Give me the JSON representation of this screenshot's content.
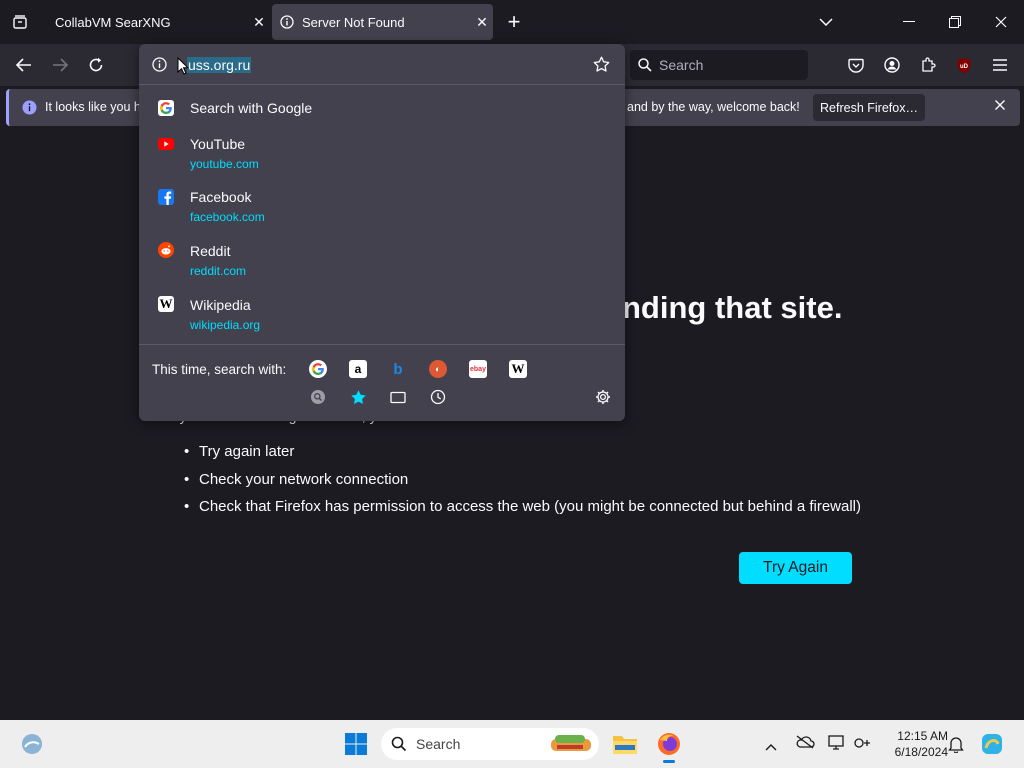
{
  "colors": {
    "accent": "#00ddff",
    "chrome_bg": "#2b2a33",
    "tab_bar_bg": "#1c1b22",
    "active_tab_bg": "#42414d",
    "dropdown_bg": "#42414d",
    "page_bg": "#1c1b22",
    "taskbar_bg": "#eeeeee"
  },
  "tabs": [
    {
      "title": "CollabVM SearXNG",
      "icon": "tab-list-icon"
    },
    {
      "title": "Server Not Found",
      "icon": "info-icon"
    }
  ],
  "toolbar": {
    "search_placeholder": "Search"
  },
  "urlbar": {
    "value": "uss.org.ru",
    "icon": "info-icon"
  },
  "notification": {
    "text_left": "It looks like you ha",
    "text_right": "and by the way, welcome back!",
    "button": "Refresh Firefox…"
  },
  "dropdown": {
    "search_with": "Search with Google",
    "results": [
      {
        "title": "YouTube",
        "url": "youtube.com",
        "icon": "youtube-icon",
        "color": "#ff0000"
      },
      {
        "title": "Facebook",
        "url": "facebook.com",
        "icon": "facebook-icon",
        "color": "#1877f2"
      },
      {
        "title": "Reddit",
        "url": "reddit.com",
        "icon": "reddit-icon",
        "color": "#ff4500"
      },
      {
        "title": "Wikipedia",
        "url": "wikipedia.org",
        "icon": "wikipedia-icon",
        "color": "#ffffff"
      }
    ],
    "oneoff_label": "This time, search with:",
    "engines": [
      "google-icon",
      "amazon-icon",
      "bing-icon",
      "duckduckgo-icon",
      "ebay-icon",
      "wikipedia-icon"
    ],
    "modes": [
      "search-history-icon",
      "bookmarks-icon",
      "tabs-icon",
      "history-icon"
    ]
  },
  "error_page": {
    "heading_visible": "nding that site.",
    "intro_partial": "If you entered the right address, you can:",
    "bullets": [
      "Try again later",
      "Check your network connection",
      "Check that Firefox has permission to access the web (you might be connected but behind a firewall)"
    ],
    "try_again": "Try Again"
  },
  "taskbar": {
    "search_placeholder": "Search",
    "time": "12:15 AM",
    "date": "6/18/2024"
  }
}
